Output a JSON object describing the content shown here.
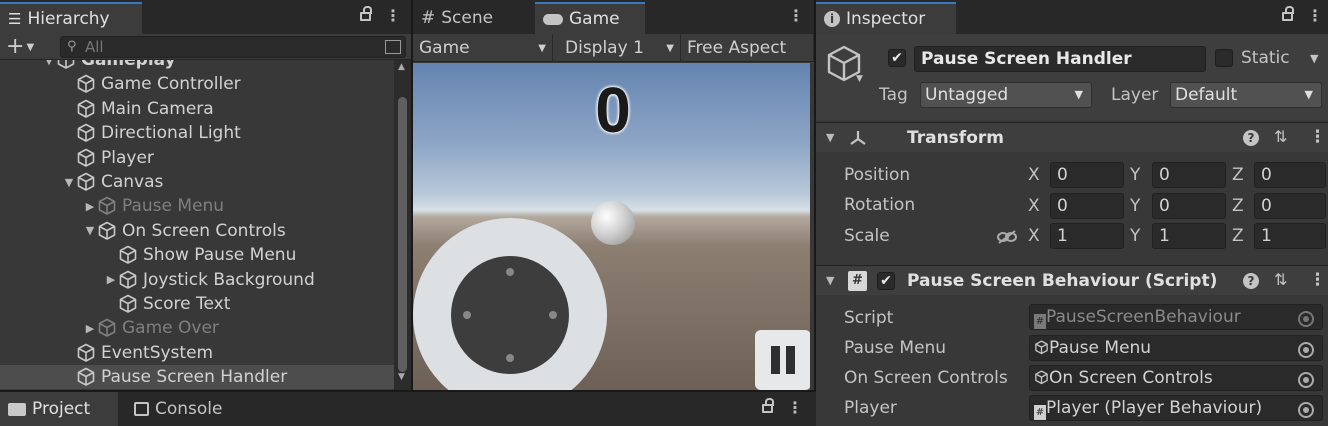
{
  "hierarchy": {
    "tab_label": "Hierarchy",
    "search_placeholder": "All",
    "items": [
      {
        "label": "Gameplay",
        "depth": 0,
        "arrow": "▼",
        "dim": false,
        "selected": false
      },
      {
        "label": "Game Controller",
        "depth": 1,
        "arrow": "",
        "dim": false,
        "selected": false
      },
      {
        "label": "Main Camera",
        "depth": 1,
        "arrow": "",
        "dim": false,
        "selected": false
      },
      {
        "label": "Directional Light",
        "depth": 1,
        "arrow": "",
        "dim": false,
        "selected": false
      },
      {
        "label": "Player",
        "depth": 1,
        "arrow": "",
        "dim": false,
        "selected": false
      },
      {
        "label": "Canvas",
        "depth": 1,
        "arrow": "▼",
        "dim": false,
        "selected": false
      },
      {
        "label": "Pause Menu",
        "depth": 2,
        "arrow": "▶",
        "dim": true,
        "selected": false
      },
      {
        "label": "On Screen Controls",
        "depth": 2,
        "arrow": "▼",
        "dim": false,
        "selected": false
      },
      {
        "label": "Show Pause Menu",
        "depth": 3,
        "arrow": "",
        "dim": false,
        "selected": false
      },
      {
        "label": "Joystick Background",
        "depth": 3,
        "arrow": "▶",
        "dim": false,
        "selected": false
      },
      {
        "label": "Score Text",
        "depth": 3,
        "arrow": "",
        "dim": false,
        "selected": false
      },
      {
        "label": "Game Over",
        "depth": 2,
        "arrow": "▶",
        "dim": true,
        "selected": false
      },
      {
        "label": "EventSystem",
        "depth": 1,
        "arrow": "",
        "dim": false,
        "selected": false
      },
      {
        "label": "Pause Screen Handler",
        "depth": 1,
        "arrow": "",
        "dim": false,
        "selected": true
      }
    ]
  },
  "bottom_tabs": {
    "project": "Project",
    "console": "Console"
  },
  "game": {
    "tab_scene": "Scene",
    "tab_game": "Game",
    "dropdown_view": "Game",
    "dropdown_display": "Display 1",
    "dropdown_aspect": "Free Aspect",
    "score": "0"
  },
  "inspector": {
    "tab_label": "Inspector",
    "object_name": "Pause Screen Handler",
    "static_label": "Static",
    "tag_label": "Tag",
    "tag_value": "Untagged",
    "layer_label": "Layer",
    "layer_value": "Default",
    "transform": {
      "title": "Transform",
      "position_label": "Position",
      "rotation_label": "Rotation",
      "scale_label": "Scale",
      "position": {
        "x": "0",
        "y": "0",
        "z": "0"
      },
      "rotation": {
        "x": "0",
        "y": "0",
        "z": "0"
      },
      "scale": {
        "x": "1",
        "y": "1",
        "z": "1"
      },
      "axis_x": "X",
      "axis_y": "Y",
      "axis_z": "Z"
    },
    "script_component": {
      "title": "Pause Screen Behaviour (Script)",
      "script_label": "Script",
      "script_value": "PauseScreenBehaviour",
      "pause_menu_label": "Pause Menu",
      "pause_menu_value": "Pause Menu",
      "osc_label": "On Screen Controls",
      "osc_value": "On Screen Controls",
      "player_label": "Player",
      "player_value": "Player (Player Behaviour)"
    }
  },
  "colors": {
    "accent": "#3a79bb",
    "panel": "#383838",
    "selected_row": "#4d4d4d"
  }
}
